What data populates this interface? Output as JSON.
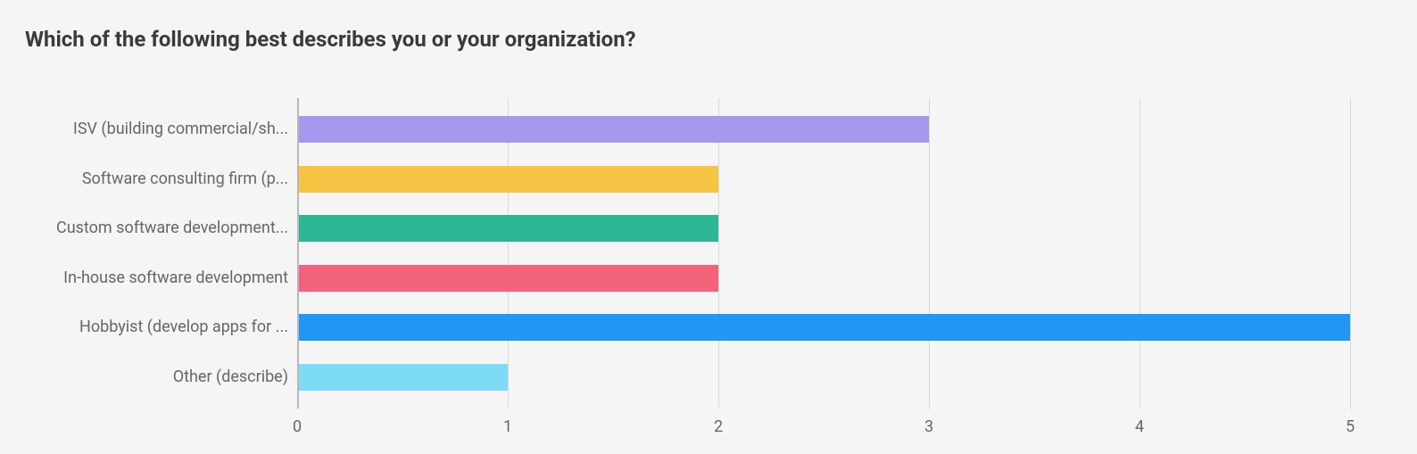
{
  "chart_data": {
    "type": "bar",
    "orientation": "horizontal",
    "title": "Which of the following best describes you or your organization?",
    "xlabel": "",
    "ylabel": "",
    "xlim": [
      0,
      5
    ],
    "xticks": [
      0,
      1,
      2,
      3,
      4,
      5
    ],
    "categories": [
      "ISV (building commercial/sh...",
      "Software consulting firm (p...",
      "Custom software development...",
      "In-house software development",
      "Hobbyist (develop apps for ...",
      "Other (describe)"
    ],
    "values": [
      3,
      2,
      2,
      2,
      5,
      1
    ],
    "colors": [
      "#a598ef",
      "#f6c344",
      "#2bb793",
      "#f3627b",
      "#2196f3",
      "#7ddbf3"
    ]
  }
}
